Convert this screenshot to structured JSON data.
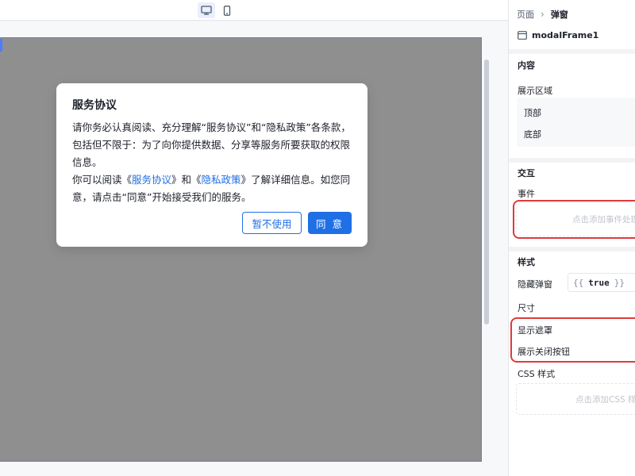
{
  "toolbar": {
    "devices": [
      {
        "icon": "desktop-icon",
        "active": true
      },
      {
        "icon": "mobile-icon",
        "active": false
      }
    ]
  },
  "modal": {
    "title": "服务协议",
    "line1": "请你务必认真阅读、充分理解“服务协议”和“隐私政策”各条款，包括但不限于：为了向你提供数据、分享等服务所要获取的权限信息。",
    "line2_prefix": "你可以阅读《",
    "link1": "服务协议",
    "line2_mid": "》和《",
    "link2": "隐私政策",
    "line2_suffix": "》了解详细信息。如您同意，请点击“同意”开始接受我们的服务。",
    "cancel_label": "暂不使用",
    "confirm_label": "同 意"
  },
  "panel": {
    "breadcrumb_root": "页面",
    "breadcrumb_current": "弹窗",
    "component_name": "modalFrame1",
    "content_title": "内容",
    "display_area_label": "展示区域",
    "display_area_items": [
      "顶部",
      "底部"
    ],
    "interaction_title": "交互",
    "event_label": "事件",
    "event_placeholder": "点击添加事件处理",
    "style_title": "样式",
    "hide_modal_label": "隐藏弹窗",
    "hide_modal_value": "true",
    "size_label": "尺寸",
    "show_mask_label": "显示遮罩",
    "show_close_label": "展示关闭按钮",
    "css_label": "CSS 样式",
    "css_placeholder": "点击添加CSS 样"
  },
  "colors": {
    "accent": "#1f6fe5",
    "highlight": "#e03a3a",
    "overlay": "#8f8f8f"
  }
}
